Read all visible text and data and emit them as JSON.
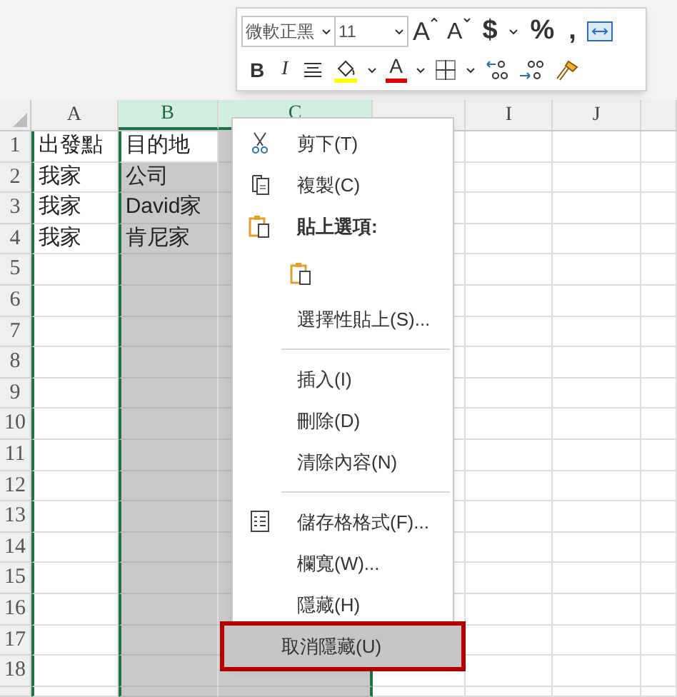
{
  "mini_toolbar": {
    "font_name": "微軟正黑",
    "font_size": "11",
    "row_1": [
      {
        "kind": "grow",
        "label": "A"
      },
      {
        "kind": "shrink",
        "label": "A"
      },
      {
        "kind": "text",
        "label": "$"
      },
      {
        "kind": "caret"
      },
      {
        "kind": "text",
        "label": "%"
      },
      {
        "kind": "text",
        "label": ","
      },
      {
        "kind": "wrap"
      }
    ],
    "row_2": [
      {
        "kind": "bold",
        "label": "B"
      },
      {
        "kind": "italic",
        "label": "I"
      },
      {
        "kind": "align"
      },
      {
        "kind": "fill",
        "color": "#ffff00"
      },
      {
        "kind": "caret"
      },
      {
        "kind": "fontcolor",
        "label": "A",
        "color": "#e00000"
      },
      {
        "kind": "caret"
      },
      {
        "kind": "borders"
      },
      {
        "kind": "caret"
      },
      {
        "kind": "incdec"
      },
      {
        "kind": "decdec"
      },
      {
        "kind": "painter"
      }
    ]
  },
  "sheet": {
    "columns": [
      {
        "label": "A",
        "selected": false
      },
      {
        "label": "B",
        "selected": true
      },
      {
        "label": "C",
        "selected": true
      },
      {
        "selected": false
      },
      {
        "label": "I",
        "selected": false
      },
      {
        "label": "J",
        "selected": false
      },
      {
        "selected": false
      }
    ],
    "rows": [
      {
        "number": "1",
        "cells": [
          "出發點",
          "目的地"
        ]
      },
      {
        "number": "2",
        "cells": [
          "我家",
          "公司"
        ]
      },
      {
        "number": "3",
        "cells": [
          "我家",
          "David家"
        ]
      },
      {
        "number": "4",
        "cells": [
          "我家",
          "肯尼家"
        ]
      },
      {
        "number": "5",
        "cells": []
      },
      {
        "number": "6",
        "cells": []
      },
      {
        "number": "7",
        "cells": []
      },
      {
        "number": "8",
        "cells": []
      },
      {
        "number": "9",
        "cells": []
      },
      {
        "number": "10",
        "cells": []
      },
      {
        "number": "11",
        "cells": []
      },
      {
        "number": "12",
        "cells": []
      },
      {
        "number": "13",
        "cells": []
      },
      {
        "number": "14",
        "cells": []
      },
      {
        "number": "15",
        "cells": []
      },
      {
        "number": "16",
        "cells": []
      },
      {
        "number": "17",
        "cells": []
      },
      {
        "number": "18",
        "cells": []
      }
    ]
  },
  "context_menu": [
    {
      "kind": "item",
      "label": "剪下(T)",
      "selected": false
    },
    {
      "kind": "item",
      "label": "複製(C)",
      "selected": false
    },
    {
      "kind": "header",
      "label": "貼上選項:"
    },
    {
      "kind": "paste_option"
    },
    {
      "kind": "item",
      "label": "選擇性貼上(S)...",
      "selected": false
    },
    {
      "kind": "separator"
    },
    {
      "kind": "item",
      "label": "插入(I)",
      "selected": false
    },
    {
      "kind": "item",
      "label": "刪除(D)",
      "selected": false
    },
    {
      "kind": "item",
      "label": "清除內容(N)",
      "selected": false
    },
    {
      "kind": "separator"
    },
    {
      "kind": "item",
      "label": "儲存格格式(F)...",
      "selected": false
    },
    {
      "kind": "item",
      "label": "欄寬(W)...",
      "selected": false
    },
    {
      "kind": "item",
      "label": "隱藏(H)",
      "selected": false
    },
    {
      "kind": "item",
      "label": "取消隱藏(U)",
      "selected": true
    }
  ]
}
